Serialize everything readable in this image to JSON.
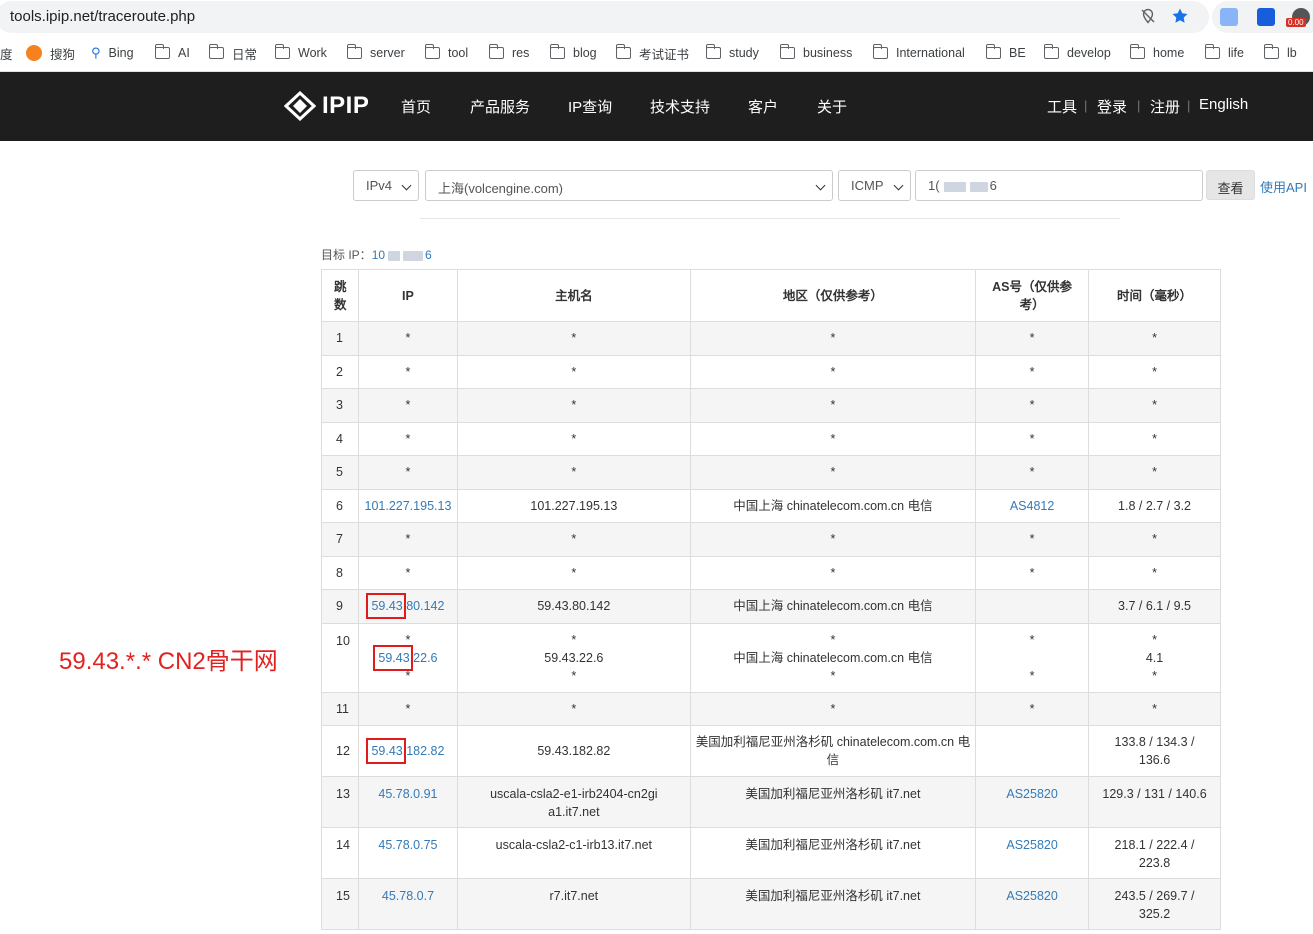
{
  "browser": {
    "url": "tools.ipip.net/traceroute.php",
    "icons": [
      "location-off-icon",
      "bookmark-star-icon",
      "translate-extension-icon",
      "bitwarden-extension-icon",
      "ext-badge-icon"
    ],
    "ext_badge": "0.00",
    "bookmarks": [
      {
        "label": "度",
        "icon": "none"
      },
      {
        "label": "搜狗",
        "icon": "sogou-icon"
      },
      {
        "label": "Bing",
        "icon": "search-icon"
      },
      {
        "label": "AI",
        "icon": "folder-icon"
      },
      {
        "label": "日常",
        "icon": "folder-icon"
      },
      {
        "label": "Work",
        "icon": "folder-icon"
      },
      {
        "label": "server",
        "icon": "folder-icon"
      },
      {
        "label": "tool",
        "icon": "folder-icon"
      },
      {
        "label": "res",
        "icon": "folder-icon"
      },
      {
        "label": "blog",
        "icon": "folder-icon"
      },
      {
        "label": "考试证书",
        "icon": "folder-icon"
      },
      {
        "label": "study",
        "icon": "folder-icon"
      },
      {
        "label": "business",
        "icon": "folder-icon"
      },
      {
        "label": "International",
        "icon": "folder-icon"
      },
      {
        "label": "BE",
        "icon": "folder-icon"
      },
      {
        "label": "develop",
        "icon": "folder-icon"
      },
      {
        "label": "home",
        "icon": "folder-icon"
      },
      {
        "label": "life",
        "icon": "folder-icon"
      },
      {
        "label": "lb",
        "icon": "folder-icon"
      }
    ]
  },
  "site": {
    "logo": "IPIP",
    "nav": [
      "首页",
      "产品服务",
      "IP查询",
      "技术支持",
      "客户",
      "关于"
    ],
    "right_nav": [
      "工具",
      "登录",
      "注册",
      "English"
    ]
  },
  "form": {
    "ip_version": "IPv4",
    "node": "上海(volcengine.com)",
    "protocol": "ICMP",
    "target_prefix": "1(",
    "target_suffix": "6",
    "submit": "查看",
    "api_link": "使用API"
  },
  "target": {
    "label": "目标 IP：",
    "value_prefix": "10",
    "value_suffix": "6"
  },
  "table": {
    "headers": [
      "跳数",
      "IP",
      "主机名",
      "地区（仅供参考）",
      "AS号（仅供参考）",
      "时间（毫秒）"
    ],
    "rows": [
      {
        "hop": "1",
        "ip": "*",
        "host": "*",
        "region": "*",
        "as": "*",
        "time": "*"
      },
      {
        "hop": "2",
        "ip": "*",
        "host": "*",
        "region": "*",
        "as": "*",
        "time": "*"
      },
      {
        "hop": "3",
        "ip": "*",
        "host": "*",
        "region": "*",
        "as": "*",
        "time": "*"
      },
      {
        "hop": "4",
        "ip": "*",
        "host": "*",
        "region": "*",
        "as": "*",
        "time": "*"
      },
      {
        "hop": "5",
        "ip": "*",
        "host": "*",
        "region": "*",
        "as": "*",
        "time": "*"
      },
      {
        "hop": "6",
        "ip": "101.227.195.13",
        "host": "101.227.195.13",
        "region": "中国上海 chinatelecom.com.cn 电信",
        "as": "AS4812",
        "time": "1.8 / 2.7 / 3.2"
      },
      {
        "hop": "7",
        "ip": "*",
        "host": "*",
        "region": "*",
        "as": "*",
        "time": "*"
      },
      {
        "hop": "8",
        "ip": "*",
        "host": "*",
        "region": "*",
        "as": "*",
        "time": "*"
      },
      {
        "hop": "9",
        "ip_hl": "59.43",
        "ip_rest": ".80.142",
        "host": "59.43.80.142",
        "region": "中国上海 chinatelecom.com.cn 电信",
        "as": "",
        "time": "3.7 / 6.1 / 9.5"
      },
      {
        "hop": "10",
        "multi": true,
        "ip_lines": [
          "*",
          "59.43",
          ".22.6",
          "*"
        ],
        "host_lines": [
          "*",
          "59.43.22.6",
          "*"
        ],
        "region_lines": [
          "*",
          "中国上海 chinatelecom.com.cn 电信",
          "*"
        ],
        "as_lines": [
          "*",
          "",
          "*"
        ],
        "time_lines": [
          "*",
          "4.1",
          "*"
        ]
      },
      {
        "hop": "11",
        "ip": "*",
        "host": "*",
        "region": "*",
        "as": "*",
        "time": "*"
      },
      {
        "hop": "12",
        "ip_hl": "59.43",
        "ip_rest": ".182.82",
        "host": "59.43.182.82",
        "region": "美国加利福尼亚州洛杉矶 chinatelecom.com.cn 电信",
        "as": "",
        "time": "133.8 / 134.3 / 136.6"
      },
      {
        "hop": "13",
        "ip": "45.78.0.91",
        "host": "uscala-csla2-e1-irb2404-cn2gia1.it7.net",
        "region": "美国加利福尼亚州洛杉矶 it7.net",
        "as": "AS25820",
        "time": "129.3 / 131 / 140.6"
      },
      {
        "hop": "14",
        "ip": "45.78.0.75",
        "host": "uscala-csla2-c1-irb13.it7.net",
        "region": "美国加利福尼亚州洛杉矶 it7.net",
        "as": "AS25820",
        "time": "218.1 / 222.4 / 223.8"
      },
      {
        "hop": "15",
        "ip": "45.78.0.7",
        "host": "r7.it7.net",
        "region": "美国加利福尼亚州洛杉矶 it7.net",
        "as": "AS25820",
        "time": "243.5 / 269.7 / 325.2"
      }
    ]
  },
  "annotation": "59.43.*.* CN2骨干网",
  "colors": {
    "link": "#337ab7",
    "highlight": "#e01b1b",
    "nav_bg": "#1e1e1e"
  }
}
